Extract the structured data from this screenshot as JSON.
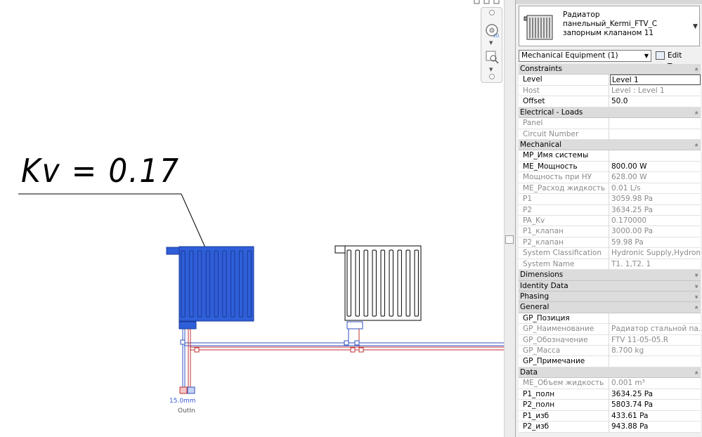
{
  "canvas": {
    "annotation": "Kv = 0.17",
    "connector_label": "15.0mm",
    "connector_sub": "OutIn"
  },
  "properties": {
    "type_name": "Радиатор панельный_Kermi_FTV_C запорным клапаном 11",
    "filter": "Mechanical Equipment (1)",
    "edit_type": "Edit Type",
    "sections": [
      {
        "title": "Constraints",
        "collapsed": false,
        "rows": [
          {
            "name": "Level",
            "value": "Level 1",
            "readonly": false,
            "editing": true
          },
          {
            "name": "Host",
            "value": "Level : Level 1",
            "readonly": true
          },
          {
            "name": "Offset",
            "value": "50.0",
            "readonly": false
          }
        ]
      },
      {
        "title": "Electrical - Loads",
        "collapsed": false,
        "rows": [
          {
            "name": "Panel",
            "value": "",
            "readonly": true
          },
          {
            "name": "Circuit Number",
            "value": "",
            "readonly": true
          }
        ]
      },
      {
        "title": "Mechanical",
        "collapsed": false,
        "rows": [
          {
            "name": "MP_Имя системы",
            "value": "",
            "readonly": false
          },
          {
            "name": "ME_Мощность",
            "value": "800.00 W",
            "readonly": false
          },
          {
            "name": "Мощность при НУ",
            "value": "628.00 W",
            "readonly": true
          },
          {
            "name": "ME_Расход жидкость",
            "value": "0.01 L/s",
            "readonly": true
          },
          {
            "name": "P1",
            "value": "3059.98 Pa",
            "readonly": true
          },
          {
            "name": "P2",
            "value": "3634.25 Pa",
            "readonly": true
          },
          {
            "name": "PA_Kv",
            "value": "0.170000",
            "readonly": true
          },
          {
            "name": "P1_клапан",
            "value": "3000.00 Pa",
            "readonly": true
          },
          {
            "name": "P2_клапан",
            "value": "59.98 Pa",
            "readonly": true
          },
          {
            "name": "System Classification",
            "value": "Hydronic Supply,Hydronic Return",
            "readonly": true
          },
          {
            "name": "System Name",
            "value": "T1. 1,T2. 1",
            "readonly": true
          }
        ]
      },
      {
        "title": "Dimensions",
        "collapsed": true,
        "rows": []
      },
      {
        "title": "Identity Data",
        "collapsed": true,
        "rows": []
      },
      {
        "title": "Phasing",
        "collapsed": true,
        "rows": []
      },
      {
        "title": "General",
        "collapsed": false,
        "rows": [
          {
            "name": "GP_Позиция",
            "value": "",
            "readonly": false
          },
          {
            "name": "GP_Наименование",
            "value": "Радиатор стальной па...",
            "readonly": true
          },
          {
            "name": "GP_Обозначение",
            "value": "FTV 11-05-05.R",
            "readonly": true
          },
          {
            "name": "GP_Масса",
            "value": "8.700 kg",
            "readonly": true
          },
          {
            "name": "GP_Примечание",
            "value": "",
            "readonly": false
          }
        ]
      },
      {
        "title": "Data",
        "collapsed": false,
        "rows": [
          {
            "name": "ME_Объем жидкость",
            "value": "0.001 m³",
            "readonly": true
          },
          {
            "name": "P1_полн",
            "value": "3634.25 Pa",
            "readonly": false
          },
          {
            "name": "P2_полн",
            "value": "5803.74 Pa",
            "readonly": false
          },
          {
            "name": "P1_изб",
            "value": "433.61 Pa",
            "readonly": false
          },
          {
            "name": "P2_изб",
            "value": "943.88 Pa",
            "readonly": false
          }
        ]
      }
    ]
  },
  "colors": {
    "selected_radiator": "#2f5fd8",
    "supply_pipe": "#3050c0",
    "return_pipe": "#c03030"
  },
  "icons": {
    "nav_wheel": "steering-wheel-icon",
    "nav_zoom": "zoom-region-icon",
    "type_thumb": "radiator-thumbnail-icon"
  }
}
